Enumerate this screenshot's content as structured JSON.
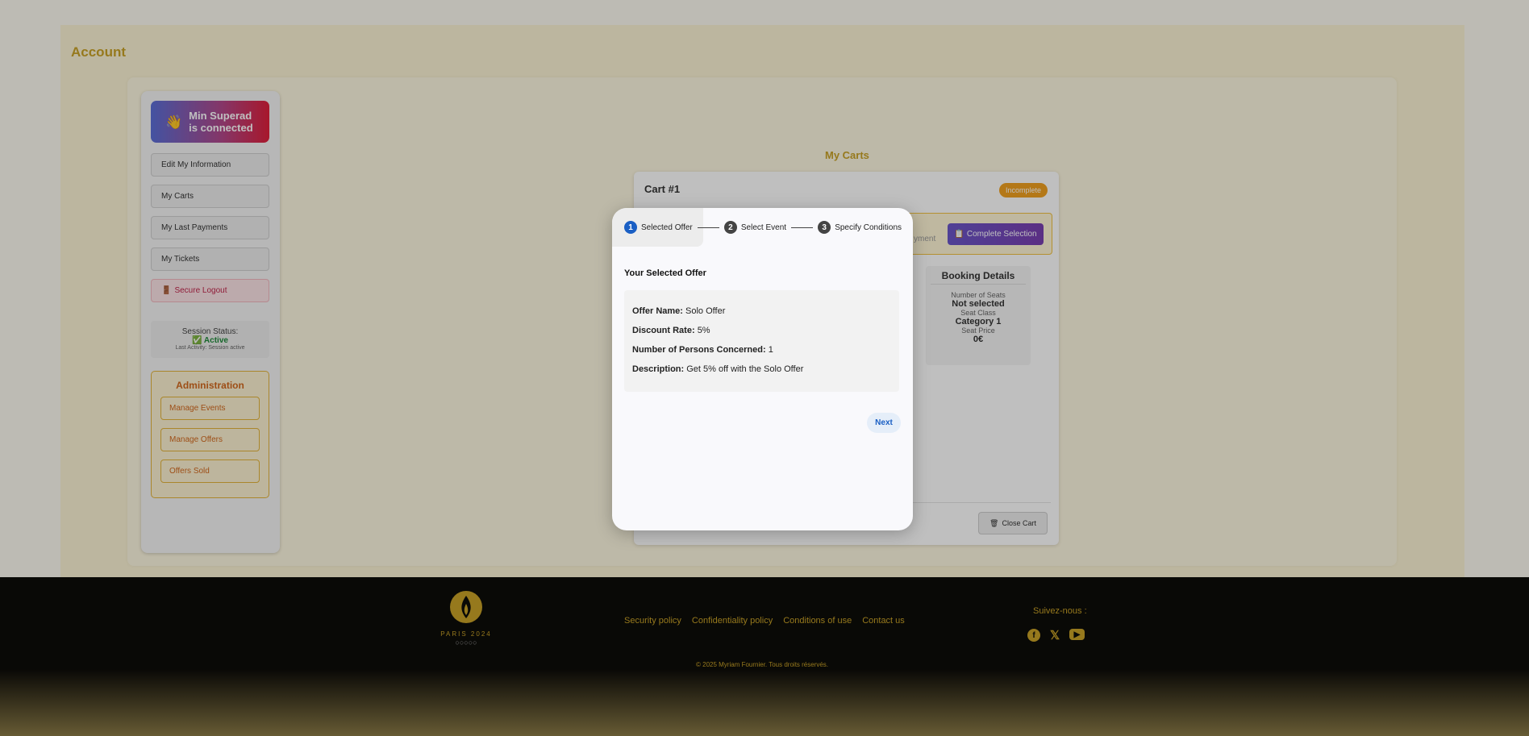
{
  "account": {
    "title": "Account"
  },
  "sidebar": {
    "user_badge": "Min Superad is connected",
    "items": [
      {
        "label": "Edit My Information"
      },
      {
        "label": "My Carts"
      },
      {
        "label": "My Last Payments"
      },
      {
        "label": "My Tickets"
      },
      {
        "label": "Secure Logout"
      }
    ],
    "session": {
      "status_label": "Session Status:",
      "status_value": "Active",
      "last_activity": "Last Activity: Session active"
    },
    "admin": {
      "title": "Administration",
      "items": [
        {
          "label": "Manage Events"
        },
        {
          "label": "Manage Offers"
        },
        {
          "label": "Offers Sold"
        }
      ]
    }
  },
  "carts": {
    "title": "My Carts",
    "cart": {
      "title": "Cart #1",
      "status": "Incomplete",
      "warning_fragment": "yment",
      "complete_label": "Complete Selection",
      "booking": {
        "title": "Booking Details",
        "seats_label": "Number of Seats",
        "seats_value": "Not selected",
        "class_label": "Seat Class",
        "class_value": "Category 1",
        "price_label": "Seat Price",
        "price_value": "0€"
      },
      "close_label": "Close Cart"
    }
  },
  "modal": {
    "steps": [
      {
        "num": "1",
        "label": "Selected Offer"
      },
      {
        "num": "2",
        "label": "Select Event"
      },
      {
        "num": "3",
        "label": "Specify Conditions"
      }
    ],
    "section_title": "Your Selected Offer",
    "offer": {
      "name_label": "Offer Name:",
      "name_value": "Solo Offer",
      "rate_label": "Discount Rate:",
      "rate_value": "5%",
      "persons_label": "Number of Persons Concerned:",
      "persons_value": "1",
      "desc_label": "Description:",
      "desc_value": "Get 5% off with the Solo Offer"
    },
    "next_label": "Next"
  },
  "footer": {
    "logo_text": "PARIS 2024",
    "links": [
      "Security policy",
      "Confidentiality policy",
      "Conditions of use",
      "Contact us"
    ],
    "follow_label": "Suivez-nous :",
    "copyright": "© 2025 Myriam Fournier. Tous droits réservés."
  },
  "colors": {
    "gold": "#c9a227",
    "accent_blue": "#1a5fc4",
    "warning": "#f0a020"
  }
}
